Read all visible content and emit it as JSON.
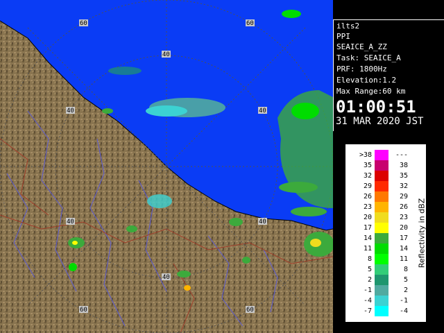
{
  "info": {
    "station": "ilts2",
    "scan_type": "PPI",
    "product": "SEAICE_A_ZZ",
    "task": "Task: SEAICE_A",
    "prf": "PRF: 1800Hz",
    "elevation": "Elevation:1.2",
    "max_range": "Max Range:60 km",
    "time": "01:00:51",
    "date": "31 MAR 2020 JST"
  },
  "range_labels": [
    "40",
    "60"
  ],
  "legend": {
    "unit": "Reflectivity in dBZ",
    "rows": [
      {
        "lo": ">38",
        "hi": "---",
        "color": "#ff00ff"
      },
      {
        "lo": "35",
        "hi": "38",
        "color": "#c8006e"
      },
      {
        "lo": "32",
        "hi": "35",
        "color": "#dc0000"
      },
      {
        "lo": "29",
        "hi": "32",
        "color": "#ff2a00"
      },
      {
        "lo": "26",
        "hi": "29",
        "color": "#ff7800"
      },
      {
        "lo": "23",
        "hi": "26",
        "color": "#ffb400"
      },
      {
        "lo": "20",
        "hi": "23",
        "color": "#f0dc1e"
      },
      {
        "lo": "17",
        "hi": "20",
        "color": "#ffff00"
      },
      {
        "lo": "14",
        "hi": "17",
        "color": "#3caa3c"
      },
      {
        "lo": "11",
        "hi": "14",
        "color": "#00dc00"
      },
      {
        "lo": "8",
        "hi": "11",
        "color": "#00ff00"
      },
      {
        "lo": "5",
        "hi": "8",
        "color": "#32cd78"
      },
      {
        "lo": "2",
        "hi": "5",
        "color": "#1e966e"
      },
      {
        "lo": "-1",
        "hi": "2",
        "color": "#50aaa0"
      },
      {
        "lo": "-4",
        "hi": "-1",
        "color": "#3cd2d2"
      },
      {
        "lo": "-7",
        "hi": "-4",
        "color": "#00ffff"
      }
    ]
  },
  "colors": {
    "sea": "#0a3cf5",
    "land": "#8a7550",
    "range_ring": "#505050",
    "river": "#5a5ad2",
    "boundary": "#a03c28"
  }
}
